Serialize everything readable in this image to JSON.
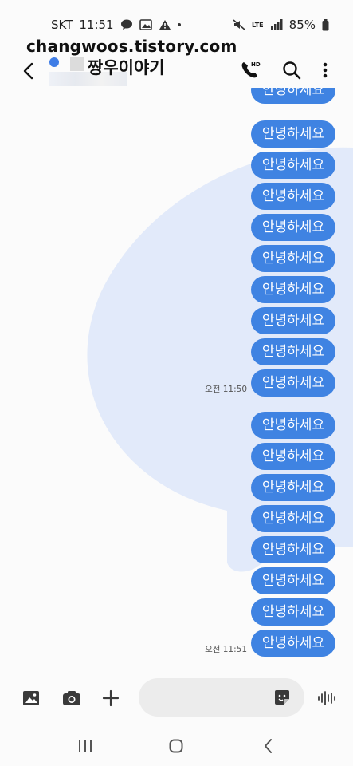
{
  "status_bar": {
    "carrier": "SKT",
    "time": "11:51",
    "network": "LTE",
    "battery": "85%"
  },
  "watermark": "changwoos.tistory.com",
  "header": {
    "contact_name": "짱우이야기"
  },
  "messages": [
    {
      "text": "안녕하세요",
      "time": ""
    },
    {
      "text": "안녕하세요",
      "time": ""
    },
    {
      "text": "안녕하세요",
      "time": ""
    },
    {
      "text": "안녕하세요",
      "time": ""
    },
    {
      "text": "안녕하세요",
      "time": ""
    },
    {
      "text": "안녕하세요",
      "time": ""
    },
    {
      "text": "안녕하세요",
      "time": ""
    },
    {
      "text": "안녕하세요",
      "time": ""
    },
    {
      "text": "안녕하세요",
      "time": ""
    },
    {
      "text": "안녕하세요",
      "time": "오전 11:50"
    },
    {
      "text": "안녕하세요",
      "time": ""
    },
    {
      "text": "안녕하세요",
      "time": ""
    },
    {
      "text": "안녕하세요",
      "time": ""
    },
    {
      "text": "안녕하세요",
      "time": ""
    },
    {
      "text": "안녕하세요",
      "time": ""
    },
    {
      "text": "안녕하세요",
      "time": ""
    },
    {
      "text": "안녕하세요",
      "time": ""
    },
    {
      "text": "안녕하세요",
      "time": "오전 11:51"
    }
  ],
  "composer": {
    "input_value": "",
    "placeholder": ""
  },
  "colors": {
    "bubble": "#3f83e2",
    "background_shape": "#e2eafa",
    "avatar": "#3f7de6"
  }
}
